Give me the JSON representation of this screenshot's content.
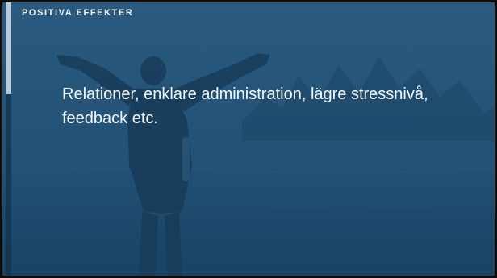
{
  "slide": {
    "section_label": "POSITIVA EFFEKTER",
    "body_text": "Relationer, enklare administration, lägre stressnivå, feedback etc."
  },
  "background": {
    "description_icon": "person-arms-raised-by-lake-photo",
    "overlay_color": "#1f4b6e",
    "accent_color": "#b9c9d7"
  }
}
